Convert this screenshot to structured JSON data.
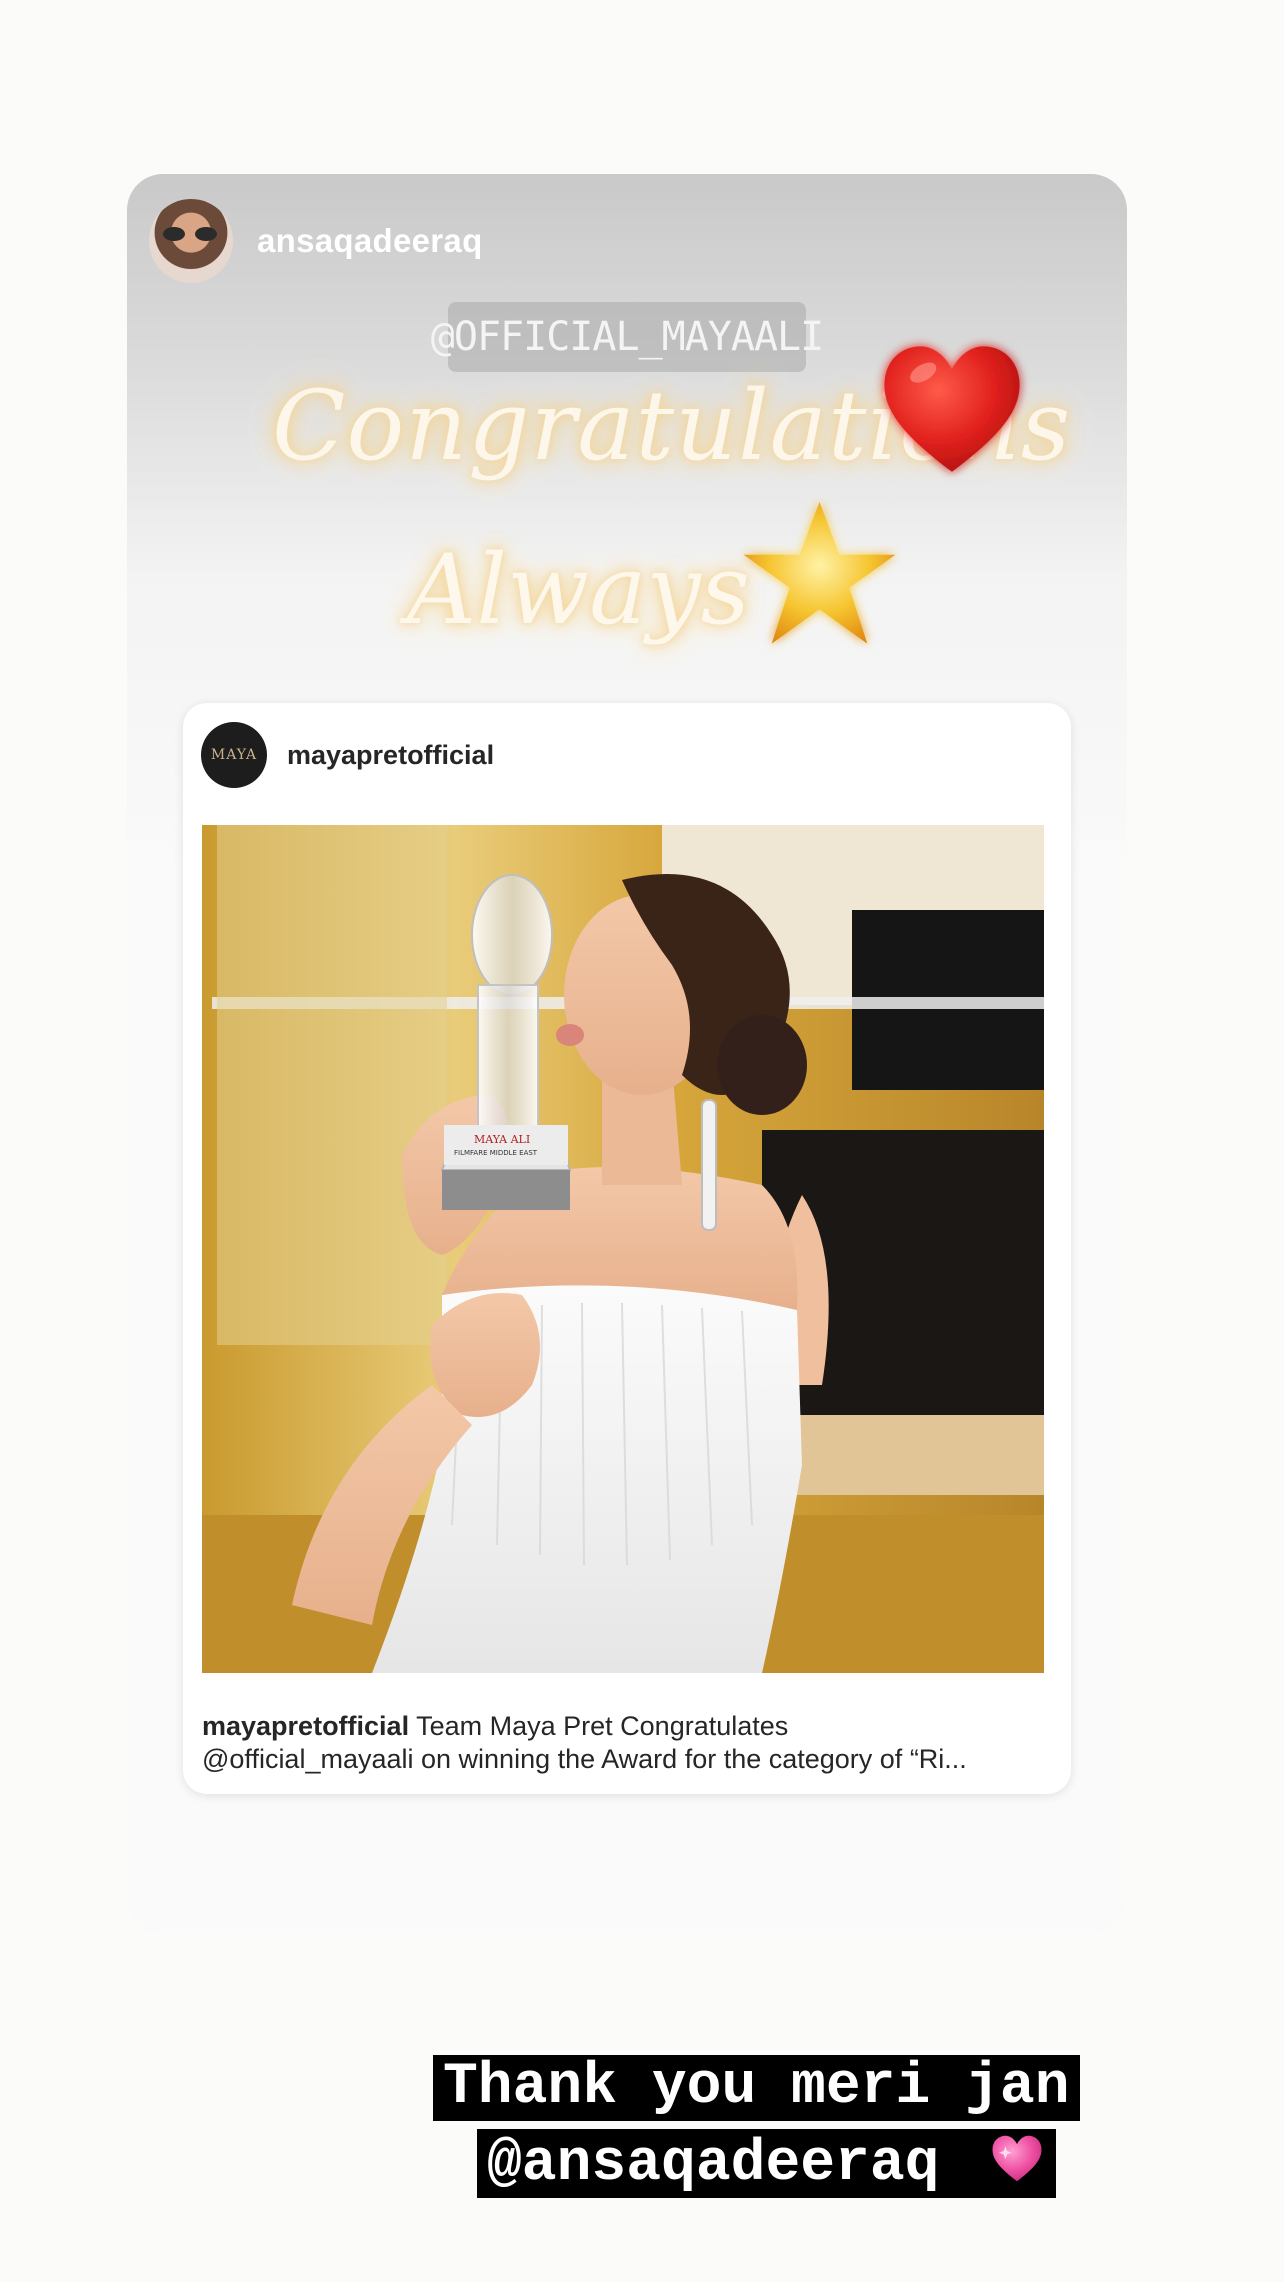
{
  "story": {
    "username": "ansaqadeeraq",
    "mention_sticker": "@OFFICIAL_MAYAALI",
    "script_line1": "Congratulations",
    "script_line2": "Always",
    "heart_icon": "red-heart-icon",
    "star_icon": "glowing-star-icon"
  },
  "post": {
    "username": "mayapretofficial",
    "avatar_text": "MAYA",
    "caption_user": "mayapretofficial",
    "caption_text": "Team Maya Pret Congratulates",
    "caption_line2": "@official_mayaali on winning the Award for the category of “Ri...",
    "trophy_brand": "MAYA ALI",
    "trophy_award": "FILMFARE MIDDLE EAST"
  },
  "reply": {
    "line1": "Thank you meri jan",
    "line2": "@ansaqadeeraq",
    "emoji_icon": "pink-sparkling-heart-icon"
  },
  "colors": {
    "background": "#fbfbf9",
    "reply_bg": "#000000",
    "heart": "#e0201c",
    "star": "#f6c531"
  }
}
